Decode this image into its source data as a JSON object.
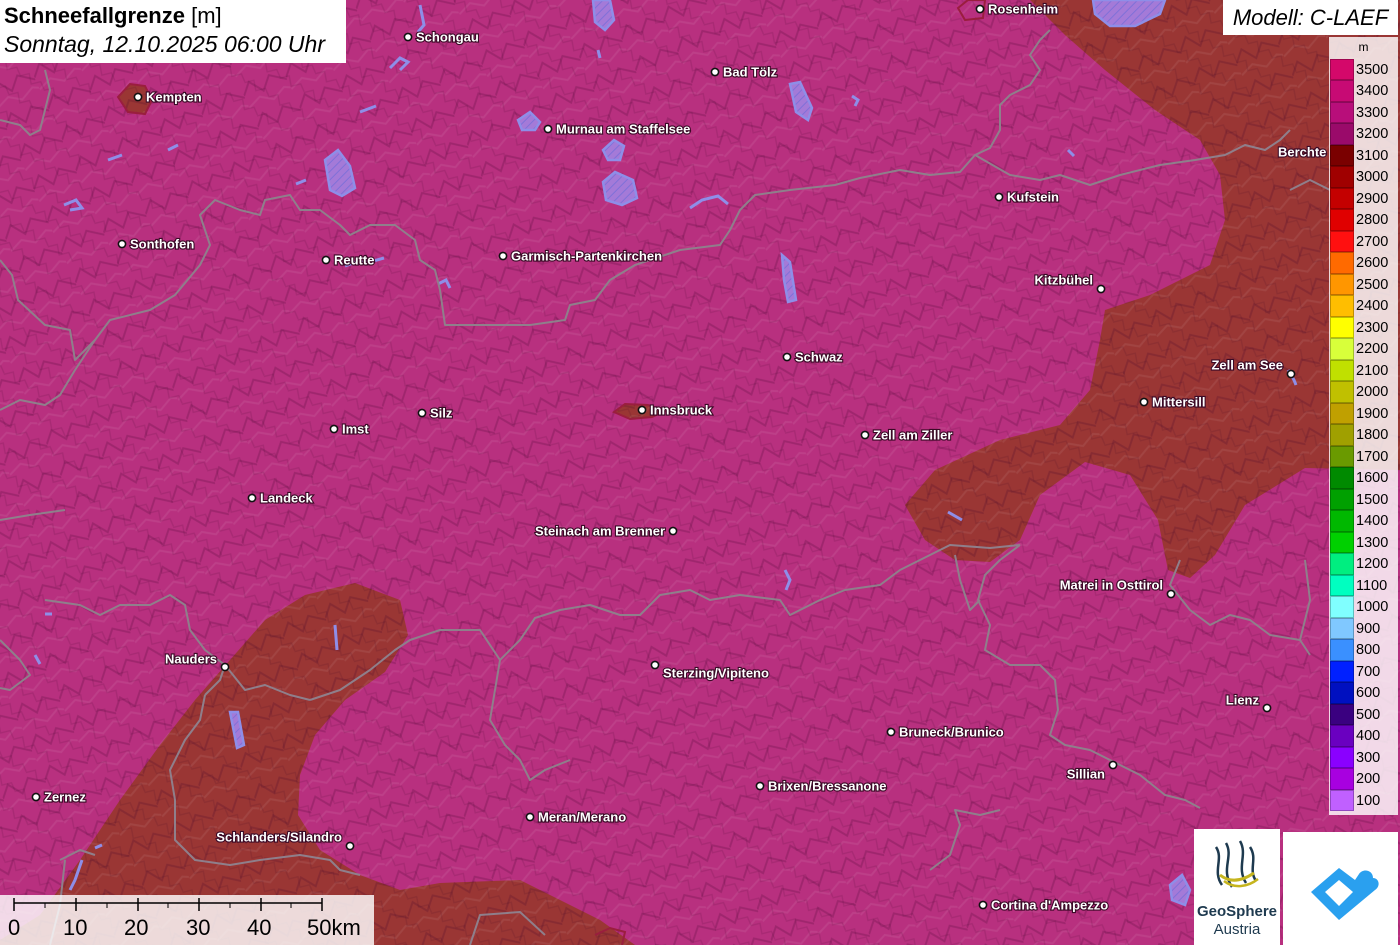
{
  "header": {
    "title_bold": "Schneefallgrenze",
    "title_unit": "[m]",
    "datetime": "Sonntag, 12.10.2025 06:00 Uhr"
  },
  "model": {
    "label": "Modell: C-LAEF"
  },
  "colors": {
    "background_pink": "#b8307f",
    "region_brown": "#9a3634",
    "border_gray": "#8f7f8b",
    "lake_blue": "#8e8ee8"
  },
  "legend": {
    "unit": "m",
    "entries": [
      {
        "label": "3500",
        "color": "#d4086a"
      },
      {
        "label": "3400",
        "color": "#c70a74"
      },
      {
        "label": "3300",
        "color": "#b80e7a"
      },
      {
        "label": "3200",
        "color": "#9a0a6a"
      },
      {
        "label": "3100",
        "color": "#7a0000"
      },
      {
        "label": "3000",
        "color": "#a00000"
      },
      {
        "label": "2900",
        "color": "#c40000"
      },
      {
        "label": "2800",
        "color": "#e00000"
      },
      {
        "label": "2700",
        "color": "#ff1010"
      },
      {
        "label": "2600",
        "color": "#ff6a00"
      },
      {
        "label": "2500",
        "color": "#ff9600"
      },
      {
        "label": "2400",
        "color": "#ffbe00"
      },
      {
        "label": "2300",
        "color": "#ffff00"
      },
      {
        "label": "2200",
        "color": "#d8ff3a"
      },
      {
        "label": "2100",
        "color": "#c0e000"
      },
      {
        "label": "2000",
        "color": "#c0c000"
      },
      {
        "label": "1900",
        "color": "#c0a000"
      },
      {
        "label": "1800",
        "color": "#a0a000"
      },
      {
        "label": "1700",
        "color": "#6a9a00"
      },
      {
        "label": "1600",
        "color": "#008a00"
      },
      {
        "label": "1500",
        "color": "#00a000"
      },
      {
        "label": "1400",
        "color": "#00b800"
      },
      {
        "label": "1300",
        "color": "#00d000"
      },
      {
        "label": "1200",
        "color": "#00ee80"
      },
      {
        "label": "1100",
        "color": "#00ffc0"
      },
      {
        "label": "1000",
        "color": "#80ffff"
      },
      {
        "label": "900",
        "color": "#80c8ff"
      },
      {
        "label": "800",
        "color": "#3a90ff"
      },
      {
        "label": "700",
        "color": "#0020ff"
      },
      {
        "label": "600",
        "color": "#0010c0"
      },
      {
        "label": "500",
        "color": "#3a0080"
      },
      {
        "label": "400",
        "color": "#6a00c0"
      },
      {
        "label": "300",
        "color": "#8a00ff"
      },
      {
        "label": "200",
        "color": "#a800e0"
      },
      {
        "label": "100",
        "color": "#c060ff"
      }
    ]
  },
  "cities": [
    {
      "name": "Rosenheim"
    },
    {
      "name": "Schongau"
    },
    {
      "name": "Kempten"
    },
    {
      "name": "Bad Tölz"
    },
    {
      "name": "Murnau am Staffelsee"
    },
    {
      "name": "Berchte"
    },
    {
      "name": "Kufstein"
    },
    {
      "name": "Sonthofen"
    },
    {
      "name": "Reutte"
    },
    {
      "name": "Garmisch-Partenkirchen"
    },
    {
      "name": "Kitzbühel"
    },
    {
      "name": "Schwaz"
    },
    {
      "name": "Zell am See"
    },
    {
      "name": "Mittersill"
    },
    {
      "name": "Imst"
    },
    {
      "name": "Silz"
    },
    {
      "name": "Innsbruck"
    },
    {
      "name": "Zell am Ziller"
    },
    {
      "name": "Landeck"
    },
    {
      "name": "Steinach am Brenner"
    },
    {
      "name": "Matrei in Osttirol"
    },
    {
      "name": "Nauders"
    },
    {
      "name": "Sterzing/Vipiteno"
    },
    {
      "name": "Lienz"
    },
    {
      "name": "Bruneck/Brunico"
    },
    {
      "name": "Sillian"
    },
    {
      "name": "Brixen/Bressanone"
    },
    {
      "name": "Zernez"
    },
    {
      "name": "Meran/Merano"
    },
    {
      "name": "Schlanders/Silandro"
    },
    {
      "name": "Cortina d'Ampezzo"
    }
  ],
  "scalebar": {
    "labels": [
      "0",
      "10",
      "20",
      "30",
      "40",
      "50km"
    ]
  },
  "logos": {
    "geosphere_line1": "GeoSphere",
    "geosphere_line2": "Austria"
  }
}
